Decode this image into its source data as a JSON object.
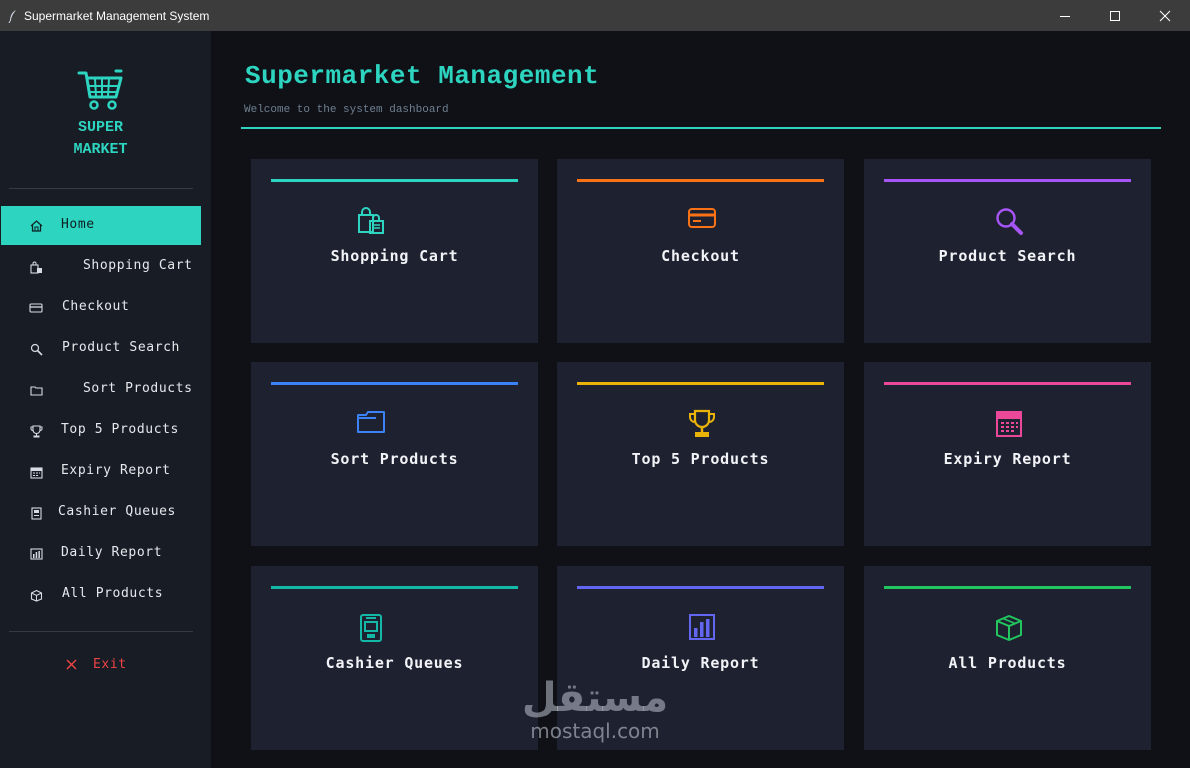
{
  "window": {
    "title": "Supermarket Management System",
    "controls": [
      "minimize",
      "maximize",
      "close"
    ]
  },
  "sidebar": {
    "logo_text": "SUPER\nMARKET",
    "items": [
      {
        "label": "Home",
        "icon": "home-icon",
        "active": true
      },
      {
        "label": "Shopping Cart",
        "icon": "shopping-bags-icon",
        "active": false
      },
      {
        "label": "Checkout",
        "icon": "credit-card-icon",
        "active": false
      },
      {
        "label": "Product Search",
        "icon": "magnifier-icon",
        "active": false
      },
      {
        "label": "Sort Products",
        "icon": "folder-icon",
        "active": false
      },
      {
        "label": "Top 5 Products",
        "icon": "trophy-icon",
        "active": false
      },
      {
        "label": "Expiry Report",
        "icon": "calendar-icon",
        "active": false
      },
      {
        "label": "Cashier Queues",
        "icon": "atm-icon",
        "active": false
      },
      {
        "label": "Daily Report",
        "icon": "bar-chart-icon",
        "active": false
      },
      {
        "label": "All Products",
        "icon": "box-icon",
        "active": false
      }
    ],
    "exit_label": "Exit"
  },
  "main": {
    "title": "Supermarket Management",
    "subtitle": "Welcome to the system dashboard"
  },
  "cards": [
    {
      "label": "Shopping Cart",
      "icon": "shopping-bags-icon",
      "accent": "#2dd4bf"
    },
    {
      "label": "Checkout",
      "icon": "credit-card-icon",
      "accent": "#f97316"
    },
    {
      "label": "Product Search",
      "icon": "magnifier-icon",
      "accent": "#a855f7"
    },
    {
      "label": "Sort Products",
      "icon": "folder-icon",
      "accent": "#3b82f6"
    },
    {
      "label": "Top 5 Products",
      "icon": "trophy-icon",
      "accent": "#eab308"
    },
    {
      "label": "Expiry Report",
      "icon": "calendar-icon",
      "accent": "#ec4899"
    },
    {
      "label": "Cashier Queues",
      "icon": "atm-icon",
      "accent": "#14b8a6"
    },
    {
      "label": "Daily Report",
      "icon": "bar-chart-icon",
      "accent": "#6366f1"
    },
    {
      "label": "All Products",
      "icon": "box-icon",
      "accent": "#22c55e"
    }
  ],
  "colors": {
    "accent": "#2dd4bf",
    "exit": "#ef4444",
    "sidebar_bg": "#181c25",
    "card_bg": "#1e2130"
  },
  "watermark": {
    "arabic": "مستقل",
    "latin": "mostaql.com"
  }
}
